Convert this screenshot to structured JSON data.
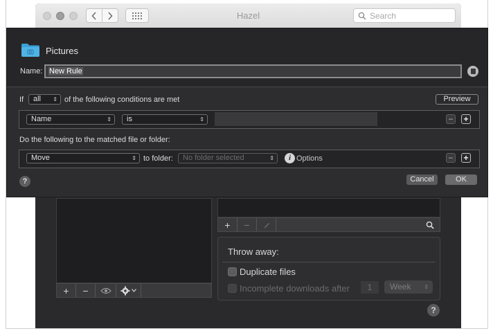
{
  "window": {
    "title": "Hazel",
    "search_placeholder": "Search",
    "nav_back_icon": "chevron-left-icon",
    "nav_forward_icon": "chevron-right-icon",
    "grid_icon": "grid-view-icon"
  },
  "sheet": {
    "folder_name": "Pictures",
    "name_label": "Name:",
    "name_value": "New Rule",
    "if_label": "If",
    "match_mode": "all",
    "conditions_text": "of the following conditions are met",
    "preview_label": "Preview",
    "condition": {
      "attribute": "Name",
      "operator": "is",
      "value": ""
    },
    "actions_label": "Do the following to the matched file or folder:",
    "action": {
      "type": "Move",
      "to_folder_label": "to folder:",
      "folder_placeholder": "No folder selected",
      "options_label": "Options"
    },
    "help_label": "?",
    "cancel_label": "Cancel",
    "ok_label": "OK"
  },
  "background": {
    "left_toolbar": {
      "add": "+",
      "remove": "−"
    },
    "right_toolbar": {
      "add": "+",
      "remove": "−"
    },
    "throw_away": {
      "title": "Throw away:",
      "duplicate_files": "Duplicate files",
      "incomplete_downloads": "Incomplete downloads after",
      "after_value": "1",
      "after_unit": "Week"
    },
    "help_label": "?"
  },
  "colors": {
    "window_bg": "#2a2a2c",
    "sheet_bg": "#2d2d2f",
    "folder_blue": "#3aa0d8"
  }
}
